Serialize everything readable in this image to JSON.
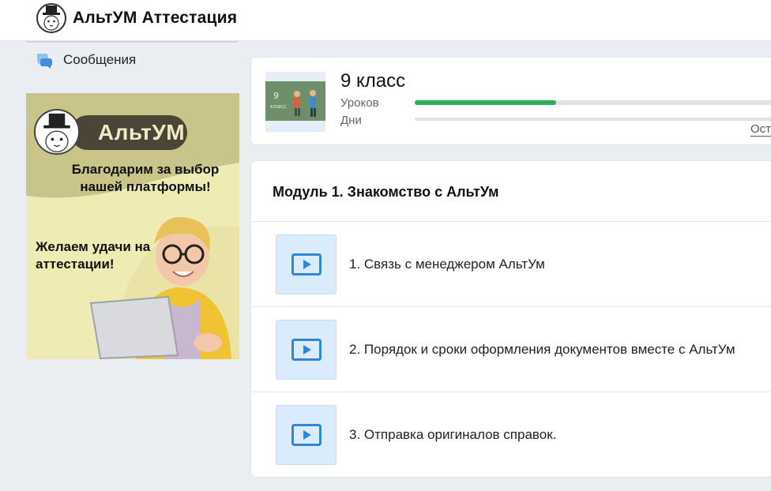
{
  "header": {
    "app_title": "АльтУМ Аттестация",
    "logo_icon": "rabbit-top-hat-logo"
  },
  "sidebar": {
    "messages": {
      "label": "Сообщения",
      "icon": "chat-bubbles-icon"
    },
    "banner": {
      "brand": "АльтУМ",
      "thanks": "Благодарим за выбор нашей платформы!",
      "wish": "Желаем удачи на аттестации!"
    }
  },
  "class_card": {
    "title": "9 класс",
    "lessons_label": "Уроков",
    "days_label": "Дни",
    "lessons_progress": 0.38,
    "days_progress": 0,
    "remaining_label": "Ост",
    "thumb_text": "9 класс"
  },
  "module": {
    "title": "Модуль 1. Знакомство с АльтУм",
    "lessons": [
      {
        "title": "1. Связь с менеджером АльтУм",
        "icon": "video-play-icon"
      },
      {
        "title": "2. Порядок и сроки оформления документов вместе с АльтУм",
        "icon": "video-play-icon"
      },
      {
        "title": "3. Отправка оригиналов справок.",
        "icon": "video-play-icon"
      }
    ]
  },
  "colors": {
    "accent_green": "#2fae57",
    "video_bg": "#daecfb",
    "video_icon": "#2f86d6"
  }
}
